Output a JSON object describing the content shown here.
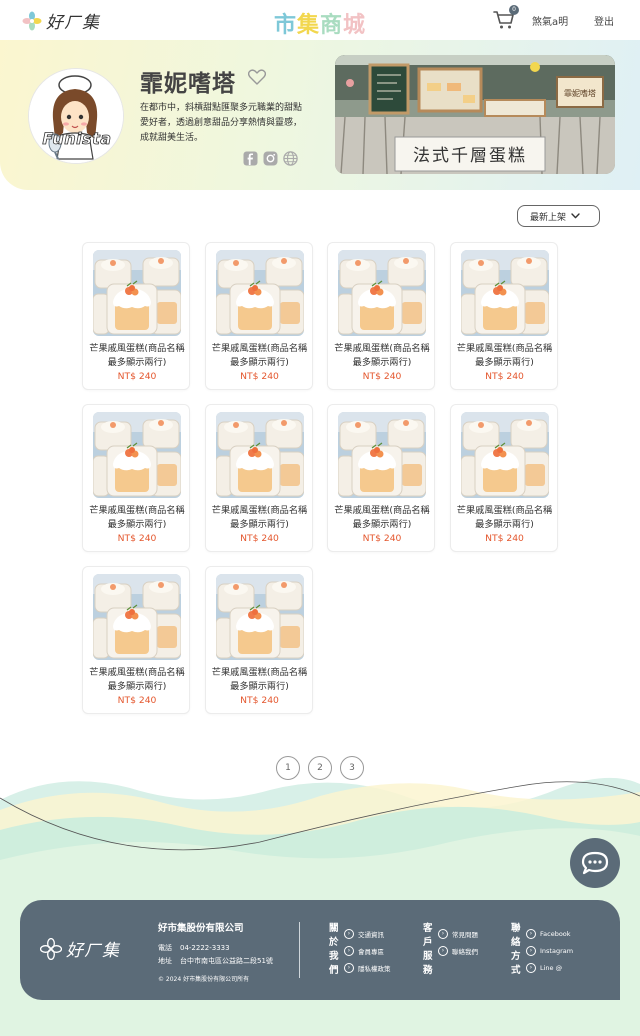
{
  "header": {
    "logo_text": "好ㄏ集",
    "site_title": [
      "市",
      "集",
      "商",
      "城"
    ],
    "site_title_colors": [
      "#7ec8d8",
      "#f2d74e",
      "#a9dcc0",
      "#f2c2c4"
    ],
    "cart_count": "0",
    "user_name": "煞氣a明",
    "logout_label": "登出"
  },
  "shop": {
    "name": "霏妮嗜塔",
    "description": "在都市中，斜槓甜點匯聚多元職業的甜點愛好者，透過創意甜品分享熱情與靈感，成就甜美生活。",
    "avatar_text": "Funista",
    "photo_sign_text": "法式千層蛋糕",
    "photo_board_text": "霏妮嗜塔"
  },
  "sort": {
    "label": "最新上架"
  },
  "products": [
    {
      "name": "芒果戚風蛋糕(商品名稱最多顯示兩行)",
      "price": "NT$ 240"
    },
    {
      "name": "芒果戚風蛋糕(商品名稱最多顯示兩行)",
      "price": "NT$ 240"
    },
    {
      "name": "芒果戚風蛋糕(商品名稱最多顯示兩行)",
      "price": "NT$ 240"
    },
    {
      "name": "芒果戚風蛋糕(商品名稱最多顯示兩行)",
      "price": "NT$ 240"
    },
    {
      "name": "芒果戚風蛋糕(商品名稱最多顯示兩行)",
      "price": "NT$ 240"
    },
    {
      "name": "芒果戚風蛋糕(商品名稱最多顯示兩行)",
      "price": "NT$ 240"
    },
    {
      "name": "芒果戚風蛋糕(商品名稱最多顯示兩行)",
      "price": "NT$ 240"
    },
    {
      "name": "芒果戚風蛋糕(商品名稱最多顯示兩行)",
      "price": "NT$ 240"
    },
    {
      "name": "芒果戚風蛋糕(商品名稱最多顯示兩行)",
      "price": "NT$ 240"
    },
    {
      "name": "芒果戚風蛋糕(商品名稱最多顯示兩行)",
      "price": "NT$ 240"
    }
  ],
  "pagination": [
    "1",
    "2",
    "3"
  ],
  "footer": {
    "logo_text": "好ㄏ集",
    "company": "好市集股份有限公司",
    "phone_label": "電話",
    "phone": "04-2222-3333",
    "address_label": "地址",
    "address": "台中市南屯區公益路二段51號",
    "copyright": "© 2024 好市集股份有限公司所有",
    "columns": [
      {
        "title": [
          "關",
          "於",
          "我",
          "們"
        ],
        "links": [
          "交通資訊",
          "會員專區",
          "隱私權政策"
        ]
      },
      {
        "title": [
          "客",
          "戶",
          "服",
          "務"
        ],
        "links": [
          "常見問題",
          "聯絡我們"
        ]
      },
      {
        "title": [
          "聯",
          "絡",
          "方",
          "式"
        ],
        "links": [
          "Facebook",
          "Instagram",
          "Line @"
        ]
      }
    ]
  },
  "colors": {
    "accent_dark": "#5b6b78",
    "price": "#e4572e"
  },
  "icons": [
    "flower-logo-icon",
    "cart-icon",
    "heart-icon",
    "facebook-icon",
    "instagram-icon",
    "globe-icon",
    "chevron-down-icon",
    "chat-icon",
    "chevron-right-icon"
  ]
}
